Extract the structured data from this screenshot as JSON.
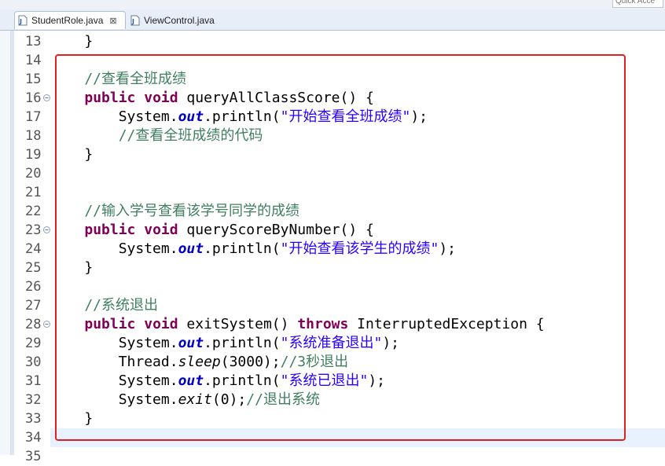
{
  "editor": {
    "quick_access": "Quick Acce",
    "tabs": [
      {
        "label": "StudentRole.java",
        "close": "⊠",
        "active": true
      },
      {
        "label": "ViewControl.java",
        "active": false
      }
    ],
    "line_numbers": [
      "13",
      "14",
      "15",
      "16",
      "17",
      "18",
      "19",
      "20",
      "21",
      "22",
      "23",
      "24",
      "25",
      "26",
      "27",
      "28",
      "29",
      "30",
      "31",
      "32",
      "33",
      "34",
      "35"
    ],
    "lines": [
      [
        {
          "t": "    }",
          "c": "p"
        }
      ],
      [],
      [
        {
          "t": "    //查看全班成绩",
          "c": "cm"
        }
      ],
      [
        {
          "t": "    ",
          "c": "p"
        },
        {
          "t": "public",
          "c": "kw"
        },
        {
          "t": " ",
          "c": "p"
        },
        {
          "t": "void",
          "c": "kw"
        },
        {
          "t": " queryAllClassScore() {",
          "c": "p"
        }
      ],
      [
        {
          "t": "        System.",
          "c": "p"
        },
        {
          "t": "out",
          "c": "fld"
        },
        {
          "t": ".println(",
          "c": "p"
        },
        {
          "t": "\"开始查看全班成绩\"",
          "c": "st"
        },
        {
          "t": ");",
          "c": "p"
        }
      ],
      [
        {
          "t": "        //查看全班成绩的代码",
          "c": "cm"
        }
      ],
      [
        {
          "t": "    }",
          "c": "p"
        }
      ],
      [],
      [],
      [
        {
          "t": "    //输入学号查看该学号同学的成绩",
          "c": "cm"
        }
      ],
      [
        {
          "t": "    ",
          "c": "p"
        },
        {
          "t": "public",
          "c": "kw"
        },
        {
          "t": " ",
          "c": "p"
        },
        {
          "t": "void",
          "c": "kw"
        },
        {
          "t": " queryScoreByNumber() {",
          "c": "p"
        }
      ],
      [
        {
          "t": "        System.",
          "c": "p"
        },
        {
          "t": "out",
          "c": "fld"
        },
        {
          "t": ".println(",
          "c": "p"
        },
        {
          "t": "\"开始查看该学生的成绩\"",
          "c": "st"
        },
        {
          "t": ");",
          "c": "p"
        }
      ],
      [
        {
          "t": "    }",
          "c": "p"
        }
      ],
      [],
      [
        {
          "t": "    //系统退出",
          "c": "cm"
        }
      ],
      [
        {
          "t": "    ",
          "c": "p"
        },
        {
          "t": "public",
          "c": "kw"
        },
        {
          "t": " ",
          "c": "p"
        },
        {
          "t": "void",
          "c": "kw"
        },
        {
          "t": " exitSystem() ",
          "c": "p"
        },
        {
          "t": "throws",
          "c": "kw"
        },
        {
          "t": " InterruptedException {",
          "c": "p"
        }
      ],
      [
        {
          "t": "        System.",
          "c": "p"
        },
        {
          "t": "out",
          "c": "fld"
        },
        {
          "t": ".println(",
          "c": "p"
        },
        {
          "t": "\"系统准备退出\"",
          "c": "st"
        },
        {
          "t": ");",
          "c": "p"
        }
      ],
      [
        {
          "t": "        Thread.",
          "c": "p"
        },
        {
          "t": "sleep",
          "c": "stat"
        },
        {
          "t": "(3000);",
          "c": "p"
        },
        {
          "t": "//3秒退出",
          "c": "cm"
        }
      ],
      [
        {
          "t": "        System.",
          "c": "p"
        },
        {
          "t": "out",
          "c": "fld"
        },
        {
          "t": ".println(",
          "c": "p"
        },
        {
          "t": "\"系统已退出\"",
          "c": "st"
        },
        {
          "t": ");",
          "c": "p"
        }
      ],
      [
        {
          "t": "        System.",
          "c": "p"
        },
        {
          "t": "exit",
          "c": "stat"
        },
        {
          "t": "(0);",
          "c": "p"
        },
        {
          "t": "//退出系统",
          "c": "cm"
        }
      ],
      [
        {
          "t": "    }",
          "c": "p"
        }
      ],
      [],
      []
    ],
    "fold_lines": [
      "16",
      "23",
      "28"
    ],
    "current_line": "34",
    "highlight_color": "#e02020"
  }
}
